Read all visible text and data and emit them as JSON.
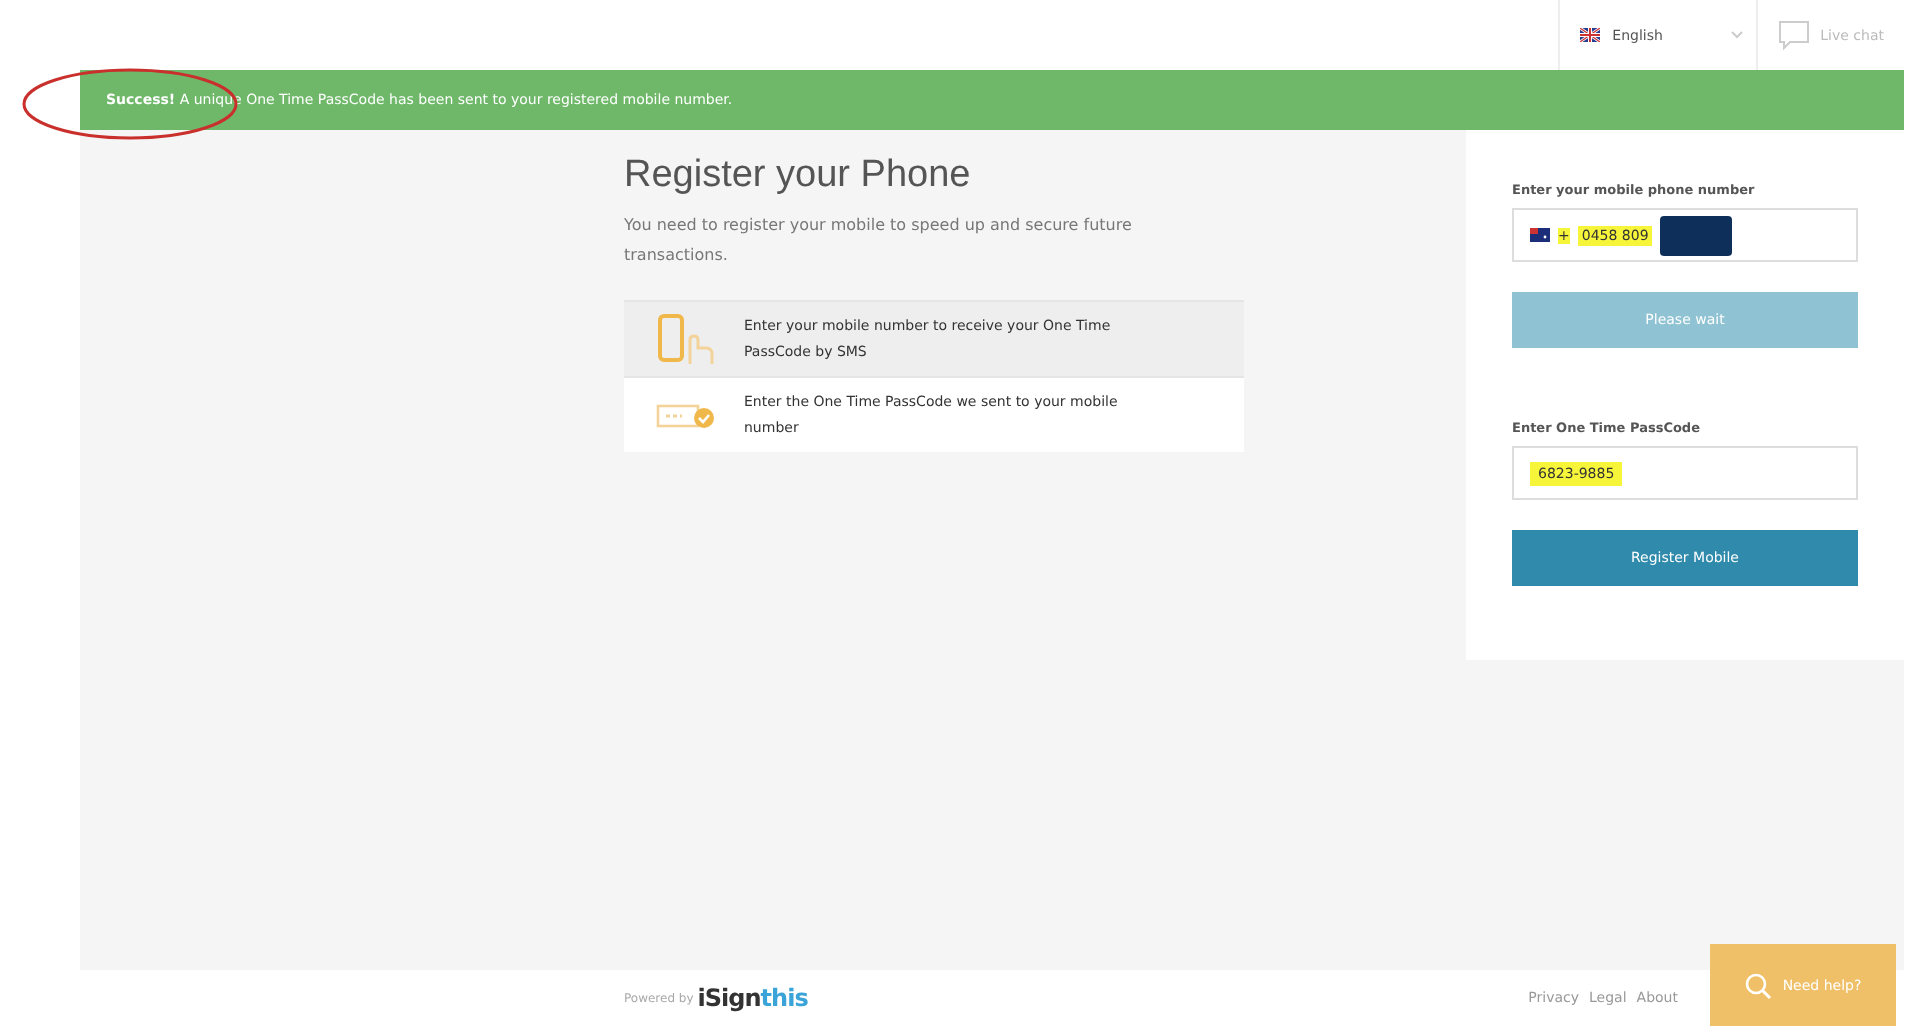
{
  "top_bar": {
    "language": "English",
    "live_chat": "Live chat"
  },
  "alert": {
    "kind": "success",
    "text": "**Success!** A unique One Time PassCode has been sent to your registered mobile number."
  },
  "annotation": {
    "kind": "ellipse"
  },
  "intro": {
    "title": "Register your Phone",
    "description": "You need to register your mobile to speed up and secure future transactions."
  },
  "steps": [
    {
      "kind": "phone",
      "text": "Enter your mobile number to receive your One Time PassCode by SMS",
      "selected": true
    },
    {
      "kind": "passcode",
      "text": "Enter the One Time PassCode we sent to your mobile number",
      "selected": false
    }
  ],
  "form": {
    "phone_label": "Enter your mobile phone number",
    "phone_prefix": "+",
    "phone_value": "0458 809",
    "phone_highlighted": true,
    "phone_redacted": true,
    "wait_button": {
      "label": "Please wait",
      "disabled": true
    },
    "passcode_label": "Enter One Time PassCode",
    "passcode_value": "6823-9885",
    "passcode_highlighted": true,
    "register_button": {
      "label": "Register Mobile",
      "disabled": false
    }
  },
  "footer": {
    "powered_by": "Powered by",
    "logo_dark": "iSign",
    "logo_light": "this",
    "links": [
      "Privacy",
      "Legal",
      "About"
    ],
    "help_button": "Need help?"
  }
}
